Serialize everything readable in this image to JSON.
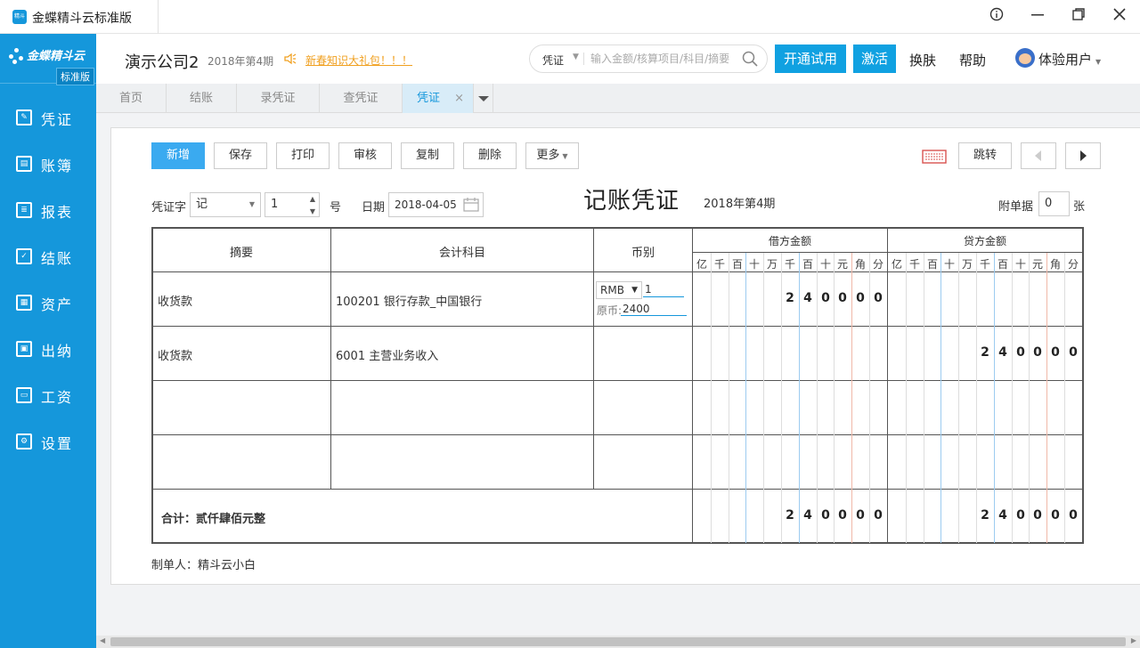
{
  "window": {
    "title": "金蝶精斗云标准版",
    "icon_text": "精斗云"
  },
  "logo": {
    "text": "金蝶精斗云",
    "edition": "标准版"
  },
  "nav": [
    {
      "label": "凭证",
      "icon": "voucher-icon"
    },
    {
      "label": "账簿",
      "icon": "ledger-icon"
    },
    {
      "label": "报表",
      "icon": "report-icon"
    },
    {
      "label": "结账",
      "icon": "checkout-icon"
    },
    {
      "label": "资产",
      "icon": "asset-icon"
    },
    {
      "label": "出纳",
      "icon": "cashier-icon"
    },
    {
      "label": "工资",
      "icon": "salary-icon"
    },
    {
      "label": "设置",
      "icon": "gear-icon"
    }
  ],
  "header": {
    "company": "演示公司2",
    "period": "2018年第4期",
    "promo": "新春知识大礼包！！！",
    "search_type": "凭证",
    "search_placeholder": "输入金额/核算项目/科目/摘要",
    "trial": "开通试用",
    "activate": "激活",
    "skin": "换肤",
    "help": "帮助",
    "user": "体验用户"
  },
  "tabs": [
    {
      "label": "首页"
    },
    {
      "label": "结账"
    },
    {
      "label": "录凭证"
    },
    {
      "label": "查凭证"
    },
    {
      "label": "凭证"
    }
  ],
  "toolbar": {
    "new": "新增",
    "save": "保存",
    "print": "打印",
    "audit": "审核",
    "copy": "复制",
    "delete": "删除",
    "more": "更多",
    "jump": "跳转"
  },
  "voucher": {
    "word_label": "凭证字",
    "word": "记",
    "number": "1",
    "number_suffix": "号",
    "date_label": "日期",
    "date": "2018-04-05",
    "title": "记账凭证",
    "period": "2018年第4期",
    "attach_label": "附单据",
    "attach": "0",
    "attach_unit": "张",
    "maker_label": "制单人：",
    "maker": "精斗云小白"
  },
  "table": {
    "h_summary": "摘要",
    "h_account": "会计科目",
    "h_currency": "币别",
    "h_debit": "借方金额",
    "h_credit": "贷方金额",
    "digits": [
      "亿",
      "千",
      "百",
      "十",
      "万",
      "千",
      "百",
      "十",
      "元",
      "角",
      "分"
    ],
    "rows": [
      {
        "summary": "收货款",
        "account": "100201 银行存款_中国银行",
        "currency": "RMB",
        "rate": "1",
        "orig_label": "原币:",
        "orig": "2400",
        "debit": "240000",
        "credit": ""
      },
      {
        "summary": "收货款",
        "account": "6001 主营业务收入",
        "currency": "",
        "rate": "",
        "orig_label": "",
        "orig": "",
        "debit": "",
        "credit": "240000"
      },
      {
        "summary": "",
        "account": "",
        "debit": "",
        "credit": ""
      },
      {
        "summary": "",
        "account": "",
        "debit": "",
        "credit": ""
      }
    ],
    "total_label": "合计：贰仟肆佰元整",
    "total_debit": "240000",
    "total_credit": "240000"
  },
  "colors": {
    "accent": "#1597db",
    "sidebar": "#1597db",
    "button_primary": "#3aaaf0"
  }
}
